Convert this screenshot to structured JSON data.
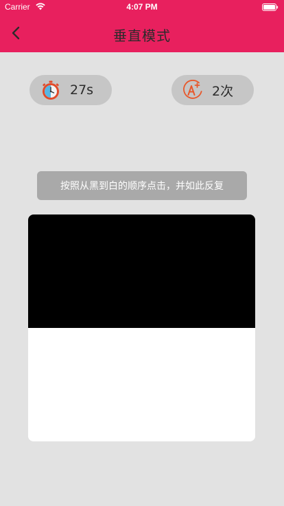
{
  "status_bar": {
    "carrier": "Carrier",
    "time": "4:07 PM"
  },
  "nav": {
    "title": "垂直模式"
  },
  "stats": {
    "timer": "27s",
    "count": "2次"
  },
  "tip": "按照从黑到白的顺序点击，并如此反复",
  "board": {
    "tiles": [
      {
        "color": "#000000"
      },
      {
        "color": "#ffffff"
      }
    ]
  },
  "colors": {
    "header": "#e8205e",
    "background": "#e2e2e2",
    "pill": "#c6c6c6",
    "tip": "#a9a9a9"
  }
}
